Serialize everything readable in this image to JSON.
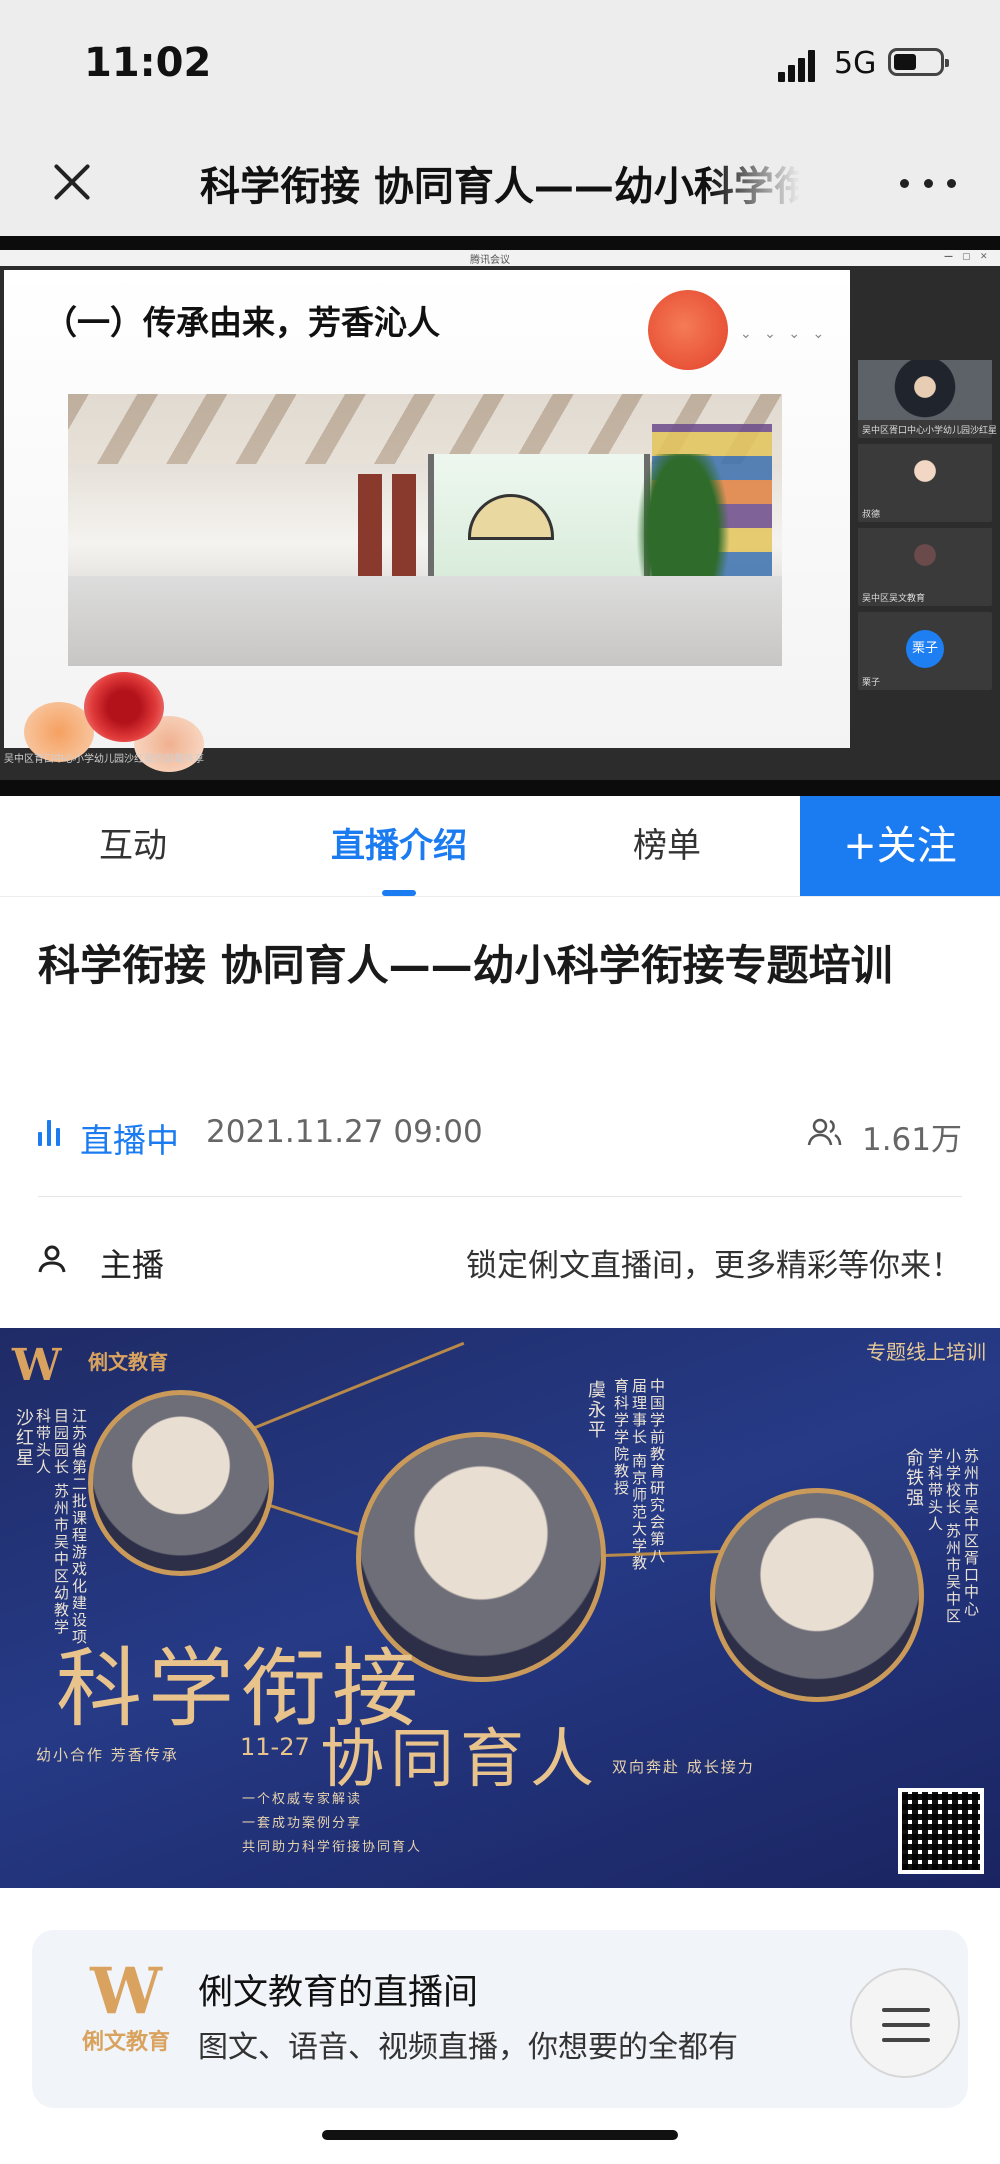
{
  "status_bar": {
    "time": "11:02",
    "network": "5G"
  },
  "nav": {
    "title": "科学衔接 协同育人——幼小科学衔接专题培训"
  },
  "video": {
    "window_title": "腾讯会议",
    "slide_heading": "（一）传承由来，芳香沁人",
    "caption": "吴中区育口中心小学幼儿园沙红星的屏幕共享",
    "participants": [
      {
        "name": "吴中区胥口中心小学幼儿园沙红星"
      },
      {
        "name": "叔德"
      },
      {
        "name": "吴中区吴文教育"
      },
      {
        "name": "栗子",
        "avatar_text": "栗子"
      }
    ]
  },
  "tabs": [
    {
      "label": "互动",
      "active": false
    },
    {
      "label": "直播介绍",
      "active": true
    },
    {
      "label": "榜单",
      "active": false
    }
  ],
  "follow_label": "+关注",
  "live": {
    "title": "科学衔接 协同育人——幼小科学衔接专题培训",
    "status": "直播中",
    "date": "2021.11.27 09:00",
    "viewers": "1.61万"
  },
  "host": {
    "label": "主播",
    "slogan": "锁定俐文直播间，更多精彩等你来！"
  },
  "poster": {
    "logo_text": "俐文教育",
    "badge": "专题线上培训",
    "speaker1": {
      "name": "沙红星",
      "title": "江苏省第二批课程游戏化建设项目园园长 苏州市吴中区幼教学科带头人"
    },
    "speaker2": {
      "name": "虞永平",
      "title": "中国学前教育研究会第八届理事长 南京师范大学教育科学学院教授"
    },
    "speaker3": {
      "name": "俞铁强",
      "title": "苏州市吴中区胥口中心小学校长 苏州市吴中区学科带头人"
    },
    "big_line1": "科学衔接",
    "big_line2": "协同育人",
    "date": "11-27",
    "slogan_left": "幼小合作  芳香传承",
    "slogan_right": "双向奔赴  成长接力",
    "bullets": [
      "一个权威专家解读",
      "一套成功案例分享",
      "共同助力科学衔接协同育人"
    ]
  },
  "channel_card": {
    "logo_text": "俐文教育",
    "title": "俐文教育的直播间",
    "subtitle": "图文、语音、视频直播，你想要的全都有"
  },
  "colors": {
    "accent": "#1b7cf2",
    "gold": "#d9a35f",
    "poster_bg": "#263a86"
  }
}
